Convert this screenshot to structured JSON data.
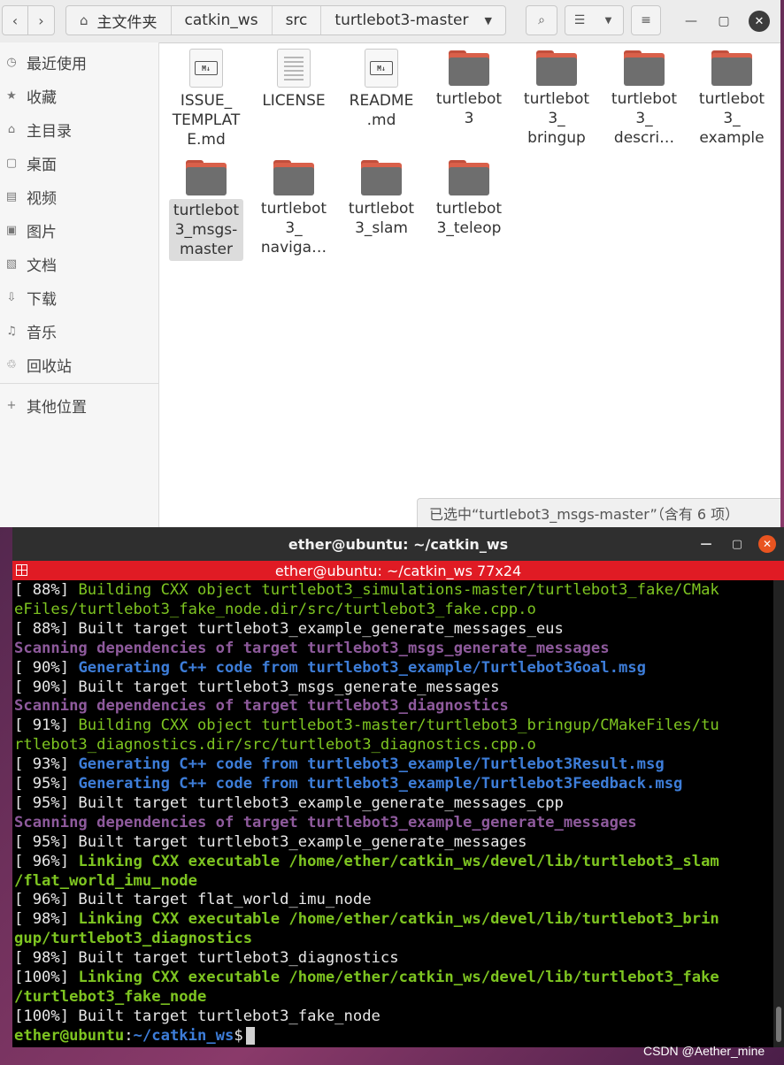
{
  "file_manager": {
    "breadcrumbs": [
      "主文件夹",
      "catkin_ws",
      "src",
      "turtlebot3-master"
    ],
    "sidebar": [
      {
        "label": "最近使用",
        "icon": "clock-icon",
        "glyph": "◷"
      },
      {
        "label": "收藏",
        "icon": "star-icon",
        "glyph": "★"
      },
      {
        "label": "主目录",
        "icon": "home-icon",
        "glyph": "⌂"
      },
      {
        "label": "桌面",
        "icon": "desktop-icon",
        "glyph": "▢"
      },
      {
        "label": "视频",
        "icon": "video-icon",
        "glyph": "▤"
      },
      {
        "label": "图片",
        "icon": "picture-icon",
        "glyph": "▣"
      },
      {
        "label": "文档",
        "icon": "document-icon",
        "glyph": "▧"
      },
      {
        "label": "下载",
        "icon": "download-icon",
        "glyph": "⇩"
      },
      {
        "label": "音乐",
        "icon": "music-icon",
        "glyph": "♫"
      },
      {
        "label": "回收站",
        "icon": "trash-icon",
        "glyph": "♲"
      },
      {
        "label": "其他位置",
        "icon": "plus-icon",
        "glyph": "+"
      }
    ],
    "files": [
      {
        "name": "ISSUE_\nTEMPLAT\nE.md",
        "type": "markdown"
      },
      {
        "name": "LICENSE",
        "type": "text"
      },
      {
        "name": "README\n.md",
        "type": "markdown"
      },
      {
        "name": "turtlebot\n3",
        "type": "folder"
      },
      {
        "name": "turtlebot\n3_\nbringup",
        "type": "folder"
      },
      {
        "name": "turtlebot\n3_\ndescri…",
        "type": "folder"
      },
      {
        "name": "turtlebot\n3_\nexample",
        "type": "folder"
      },
      {
        "name": "turtlebot\n3_msgs-\nmaster",
        "type": "folder",
        "selected": true
      },
      {
        "name": "turtlebot\n3_\nnaviga…",
        "type": "folder"
      },
      {
        "name": "turtlebot\n3_slam",
        "type": "folder"
      },
      {
        "name": "turtlebot\n3_teleop",
        "type": "folder"
      }
    ],
    "status": "已选中“turtlebot3_msgs-master”（含有 6 项）"
  },
  "terminal": {
    "title": "ether@ubuntu: ~/catkin_ws",
    "subtitle": "ether@ubuntu: ~/catkin_ws 77x24",
    "lines": [
      [
        {
          "t": "[ 88%] ",
          "c": "white"
        },
        {
          "t": "Building CXX object turtlebot3_simulations-master/turtlebot3_fake/CMak",
          "c": "green"
        }
      ],
      [
        {
          "t": "eFiles/turtlebot3_fake_node.dir/src/turtlebot3_fake.cpp.o",
          "c": "green"
        }
      ],
      [
        {
          "t": "[ 88%] Built target turtlebot3_example_generate_messages_eus",
          "c": "white"
        }
      ],
      [
        {
          "t": "Scanning dependencies of target turtlebot3_msgs_generate_messages",
          "c": "magenta"
        }
      ],
      [
        {
          "t": "[ 90%] ",
          "c": "white"
        },
        {
          "t": "Generating C++ code from turtlebot3_example/Turtlebot3Goal.msg",
          "c": "blue"
        }
      ],
      [
        {
          "t": "[ 90%] Built target turtlebot3_msgs_generate_messages",
          "c": "white"
        }
      ],
      [
        {
          "t": "Scanning dependencies of target turtlebot3_diagnostics",
          "c": "magenta"
        }
      ],
      [
        {
          "t": "[ 91%] ",
          "c": "white"
        },
        {
          "t": "Building CXX object turtlebot3-master/turtlebot3_bringup/CMakeFiles/tu",
          "c": "green"
        }
      ],
      [
        {
          "t": "rtlebot3_diagnostics.dir/src/turtlebot3_diagnostics.cpp.o",
          "c": "green"
        }
      ],
      [
        {
          "t": "[ 93%] ",
          "c": "white"
        },
        {
          "t": "Generating C++ code from turtlebot3_example/Turtlebot3Result.msg",
          "c": "blue"
        }
      ],
      [
        {
          "t": "[ 95%] ",
          "c": "white"
        },
        {
          "t": "Generating C++ code from turtlebot3_example/Turtlebot3Feedback.msg",
          "c": "blue"
        }
      ],
      [
        {
          "t": "[ 95%] Built target turtlebot3_example_generate_messages_cpp",
          "c": "white"
        }
      ],
      [
        {
          "t": "Scanning dependencies of target turtlebot3_example_generate_messages",
          "c": "magenta"
        }
      ],
      [
        {
          "t": "[ 95%] Built target turtlebot3_example_generate_messages",
          "c": "white"
        }
      ],
      [
        {
          "t": "[ 96%] ",
          "c": "white"
        },
        {
          "t": "Linking CXX executable /home/ether/catkin_ws/devel/lib/turtlebot3_slam",
          "c": "bgreen"
        }
      ],
      [
        {
          "t": "/flat_world_imu_node",
          "c": "bgreen"
        }
      ],
      [
        {
          "t": "[ 96%] Built target flat_world_imu_node",
          "c": "white"
        }
      ],
      [
        {
          "t": "[ 98%] ",
          "c": "white"
        },
        {
          "t": "Linking CXX executable /home/ether/catkin_ws/devel/lib/turtlebot3_brin",
          "c": "bgreen"
        }
      ],
      [
        {
          "t": "gup/turtlebot3_diagnostics",
          "c": "bgreen"
        }
      ],
      [
        {
          "t": "[ 98%] Built target turtlebot3_diagnostics",
          "c": "white"
        }
      ],
      [
        {
          "t": "[100%] ",
          "c": "white"
        },
        {
          "t": "Linking CXX executable /home/ether/catkin_ws/devel/lib/turtlebot3_fake",
          "c": "bgreen"
        }
      ],
      [
        {
          "t": "/turtlebot3_fake_node",
          "c": "bgreen"
        }
      ],
      [
        {
          "t": "[100%] Built target turtlebot3_fake_node",
          "c": "white"
        }
      ]
    ],
    "prompt": {
      "user": "ether@ubuntu",
      "sep": ":",
      "path": "~/catkin_ws",
      "sign": "$"
    }
  },
  "watermark": "CSDN @Aether_mine",
  "colors": {
    "terminal_header": "#e01b24",
    "close_button": "#e95420",
    "folder": "#d9604a"
  }
}
